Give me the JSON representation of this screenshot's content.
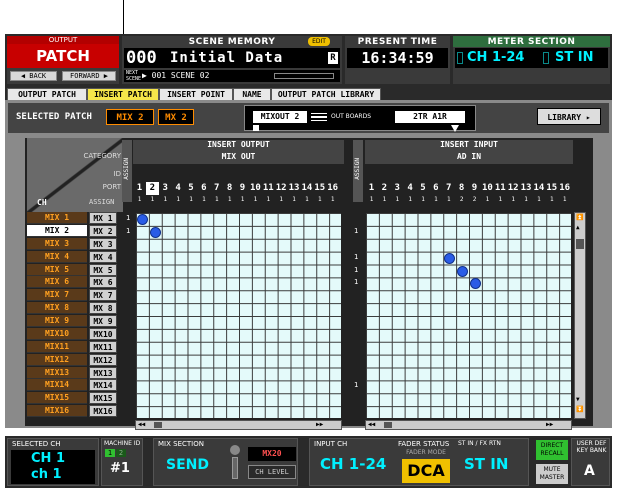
{
  "header": {
    "output": {
      "label": "OUTPUT",
      "value": "PATCH"
    },
    "nav": {
      "back": "◀ BACK",
      "forward": "FORWARD ▶"
    },
    "scene": {
      "title": "SCENE MEMORY",
      "edit_badge": "EDIT",
      "number": "000",
      "name": "Initial Data",
      "r_flag": "R",
      "next_label": "NEXT SCENE",
      "next_value": "▶ 001 SCENE 02"
    },
    "present_time": {
      "title": "PRESENT TIME",
      "value": "16:34:59"
    },
    "meter": {
      "title": "METER SECTION",
      "ch": "CH 1-24",
      "stin": "ST IN"
    }
  },
  "tabs": [
    {
      "label": "OUTPUT PATCH",
      "active": false
    },
    {
      "label": "INSERT PATCH",
      "active": true
    },
    {
      "label": "INSERT POINT",
      "active": false
    },
    {
      "label": "NAME",
      "active": false
    },
    {
      "label": "OUTPUT PATCH LIBRARY",
      "active": false
    }
  ],
  "selected_patch": {
    "label": "SELECTED PATCH",
    "value1": "MIX 2",
    "value2": "MX 2"
  },
  "routing": {
    "source": "MIXOUT 2",
    "via": "OUT BOARDS",
    "dest": "2TR A1R"
  },
  "library_label": "LIBRARY",
  "left_grid": {
    "section": "INSERT OUTPUT",
    "category_value": "MIX OUT",
    "assign": "ASSIGN",
    "cols": [
      "1",
      "2",
      "3",
      "4",
      "5",
      "6",
      "7",
      "8",
      "9",
      "10",
      "11",
      "12",
      "13",
      "14",
      "15",
      "16"
    ],
    "sub": [
      "1",
      "1",
      "1",
      "1",
      "1",
      "1",
      "1",
      "1",
      "1",
      "1",
      "1",
      "1",
      "1",
      "1",
      "1",
      "1"
    ],
    "highlight_col": 2
  },
  "right_grid": {
    "section": "INSERT INPUT",
    "category_value": "AD IN",
    "assign": "ASSIGN",
    "cols": [
      "1",
      "2",
      "3",
      "4",
      "5",
      "6",
      "7",
      "8",
      "9",
      "10",
      "11",
      "12",
      "13",
      "14",
      "15",
      "16"
    ],
    "sub": [
      "1",
      "1",
      "1",
      "1",
      "1",
      "1",
      "1",
      "2",
      "2",
      "1",
      "1",
      "1",
      "1",
      "1",
      "1",
      "1"
    ]
  },
  "row_header": {
    "category": "CATEGORY",
    "id": "ID",
    "port": "PORT",
    "ch": "CH",
    "assign": "ASSIGN"
  },
  "rows": [
    {
      "ch": "MIX 1",
      "assign": "MX 1",
      "left_mark": "1",
      "right_mark": ""
    },
    {
      "ch": "MIX 2",
      "assign": "MX 2",
      "left_mark": "1",
      "right_mark": "1"
    },
    {
      "ch": "MIX 3",
      "assign": "MX 3",
      "left_mark": "",
      "right_mark": ""
    },
    {
      "ch": "MIX 4",
      "assign": "MX 4",
      "left_mark": "",
      "right_mark": "1"
    },
    {
      "ch": "MIX 5",
      "assign": "MX 5",
      "left_mark": "",
      "right_mark": "1"
    },
    {
      "ch": "MIX 6",
      "assign": "MX 6",
      "left_mark": "",
      "right_mark": "1"
    },
    {
      "ch": "MIX 7",
      "assign": "MX 7",
      "left_mark": "",
      "right_mark": ""
    },
    {
      "ch": "MIX 8",
      "assign": "MX 8",
      "left_mark": "",
      "right_mark": ""
    },
    {
      "ch": "MIX 9",
      "assign": "MX 9",
      "left_mark": "",
      "right_mark": ""
    },
    {
      "ch": "MIX10",
      "assign": "MX10",
      "left_mark": "",
      "right_mark": ""
    },
    {
      "ch": "MIX11",
      "assign": "MX11",
      "left_mark": "",
      "right_mark": ""
    },
    {
      "ch": "MIX12",
      "assign": "MX12",
      "left_mark": "",
      "right_mark": ""
    },
    {
      "ch": "MIX13",
      "assign": "MX13",
      "left_mark": "",
      "right_mark": ""
    },
    {
      "ch": "MIX14",
      "assign": "MX14",
      "left_mark": "",
      "right_mark": "1"
    },
    {
      "ch": "MIX15",
      "assign": "MX15",
      "left_mark": "",
      "right_mark": ""
    },
    {
      "ch": "MIX16",
      "assign": "MX16",
      "left_mark": "",
      "right_mark": ""
    }
  ],
  "selected_row": 2,
  "left_dots": [
    {
      "row": 1,
      "col": 1
    },
    {
      "row": 2,
      "col": 2
    }
  ],
  "right_dots": [
    {
      "row": 4,
      "col": 7
    },
    {
      "row": 5,
      "col": 8
    },
    {
      "row": 6,
      "col": 9
    }
  ],
  "footer": {
    "selected_ch": {
      "label": "SELECTED CH",
      "line1": "CH 1",
      "line2": "ch 1"
    },
    "machine_id": {
      "label": "MACHINE ID",
      "b1": "1",
      "b2": "2",
      "value": "#1"
    },
    "mix_section": {
      "label": "MIX SECTION",
      "send": "SEND",
      "mix": "MX20",
      "level": "CH LEVEL"
    },
    "input_ch": {
      "label": "INPUT CH",
      "value": "CH 1-24"
    },
    "fader_status": {
      "label": "FADER STATUS",
      "mode": "FADER MODE",
      "value": "DCA"
    },
    "stin": {
      "label": "ST IN / FX RTN",
      "value": "ST IN"
    },
    "direct_recall": "DIRECT RECALL",
    "mute_master": "MUTE MASTER",
    "user_def": {
      "label": "USER DEF KEY BANK",
      "value": "A"
    }
  },
  "colors": {
    "accent_orange": "#ff8c00",
    "lcd_cyan": "#00f0ff",
    "dot_blue": "#2a5ce6",
    "grid_bg": "#e4fafa",
    "active_tab": "#f5e64a"
  }
}
